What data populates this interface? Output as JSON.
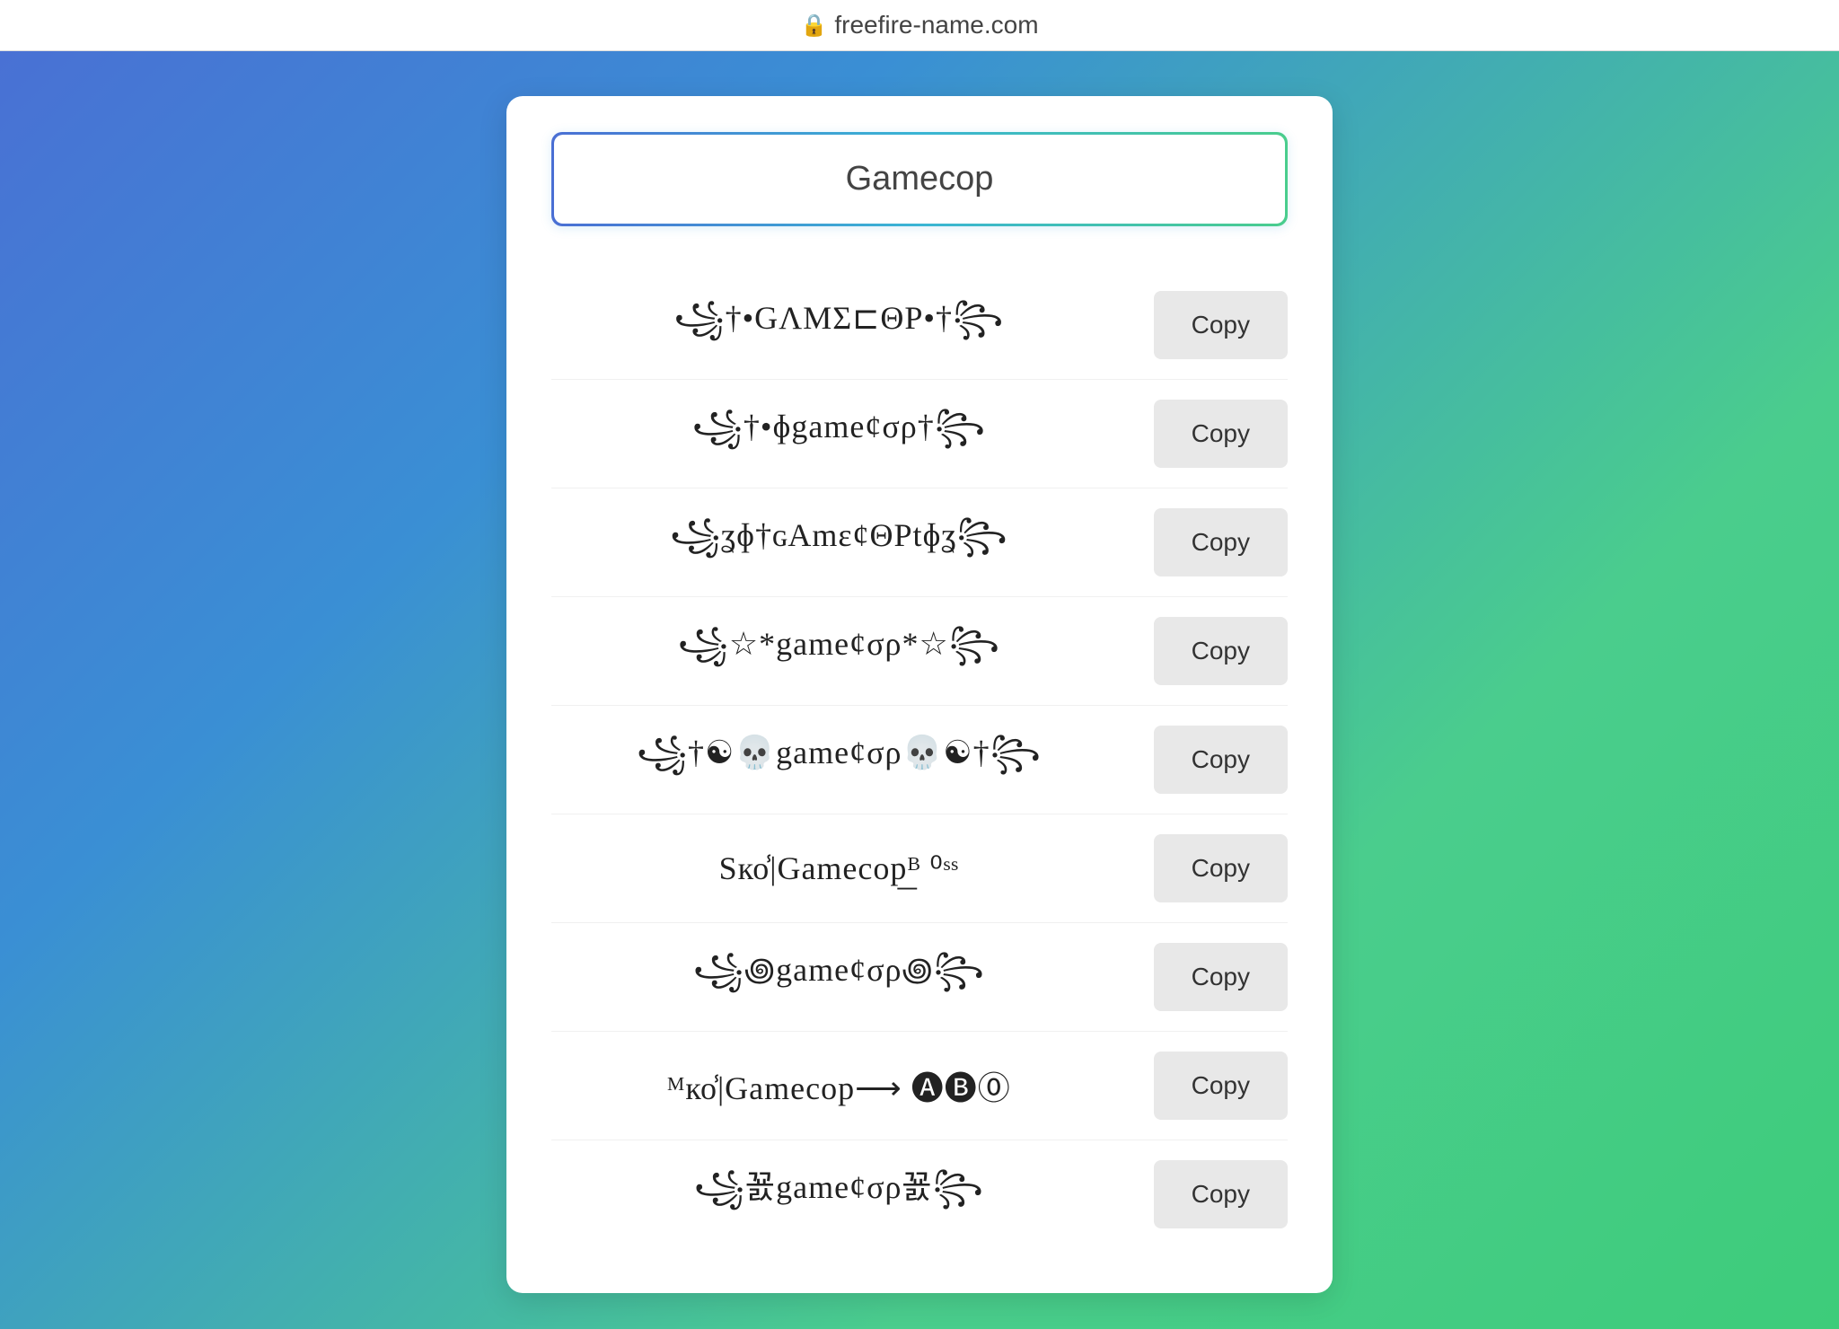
{
  "topbar": {
    "url": "freefire-name.com",
    "lock_label": "🔒"
  },
  "search": {
    "value": "Gamecop",
    "placeholder": "Gamecop"
  },
  "names": [
    {
      "id": 1,
      "text": "꧁†•GΛMΣ⊏ΘP•†꧂",
      "copy_label": "Copy"
    },
    {
      "id": 2,
      "text": "꧁†•ɸgame¢σρ†꧂",
      "copy_label": "Copy"
    },
    {
      "id": 3,
      "text": "꧁ʓɸ†ɢAmɛ¢ΘPtɸʓ꧂",
      "copy_label": "Copy"
    },
    {
      "id": 4,
      "text": "꧁☆*game¢σρ*☆꧂",
      "copy_label": "Copy"
    },
    {
      "id": 5,
      "text": "꧁†☯💀game¢σρ💀☯†꧂",
      "copy_label": "Copy"
    },
    {
      "id": 6,
      "text": "Sко̾|Gamecop͟ᴮ ⁰ˢˢ",
      "copy_label": "Copy"
    },
    {
      "id": 7,
      "text": "꧁꩜game¢σρ꩜꧂",
      "copy_label": "Copy"
    },
    {
      "id": 8,
      "text": "ᴹко̾|Gamecop⟶ 🅐🅑⓪",
      "copy_label": "Copy"
    },
    {
      "id": 9,
      "text": "꧁꾨game¢σρ꾨꧂",
      "copy_label": "Copy"
    }
  ],
  "buttons": {
    "copy": "Copy"
  }
}
